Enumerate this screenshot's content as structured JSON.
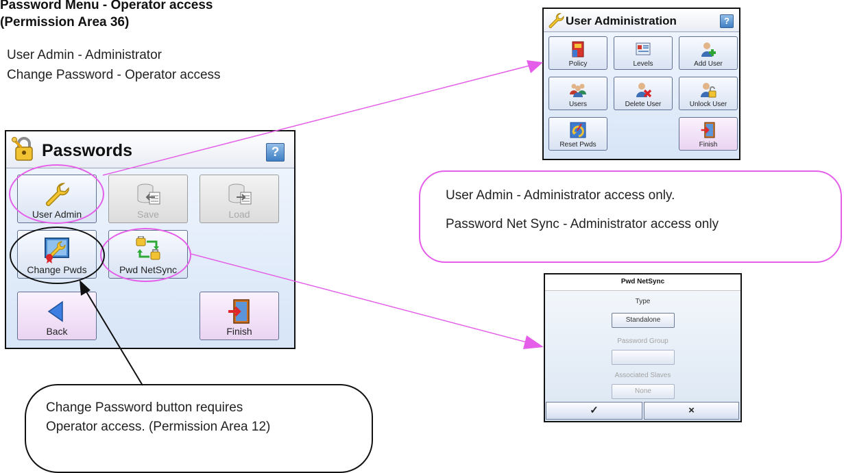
{
  "header": {
    "title_line1": "Password Menu - Operator access",
    "title_line2": "(Permission Area 36)",
    "line1": "User Admin - Administrator",
    "line2": "Change Password - Operator access"
  },
  "passwords_window": {
    "title": "Passwords",
    "help": "?",
    "buttons": [
      {
        "label": "User Admin",
        "icon": "wrench-icon",
        "enabled": true
      },
      {
        "label": "Save",
        "icon": "database-export-icon",
        "enabled": false
      },
      {
        "label": "Load",
        "icon": "database-import-icon",
        "enabled": false
      },
      {
        "label": "Change Pwds",
        "icon": "certificate-wrench-icon",
        "enabled": true
      },
      {
        "label": "Pwd NetSync",
        "icon": "sync-locks-icon",
        "enabled": true
      },
      {
        "label": "Back",
        "icon": "back-arrow-icon",
        "enabled": true
      },
      {
        "label": "Finish",
        "icon": "exit-door-icon",
        "enabled": true
      }
    ]
  },
  "user_admin_window": {
    "title": "User Administration",
    "help": "?",
    "buttons": [
      {
        "label": "Policy",
        "icon": "policy-binder-icon"
      },
      {
        "label": "Levels",
        "icon": "levels-card-icon"
      },
      {
        "label": "Add User",
        "icon": "add-user-icon"
      },
      {
        "label": "Users",
        "icon": "users-group-icon"
      },
      {
        "label": "Delete User",
        "icon": "delete-user-icon"
      },
      {
        "label": "Unlock User",
        "icon": "unlock-user-icon"
      },
      {
        "label": "Reset Pwds",
        "icon": "reset-password-icon"
      },
      {
        "label": "Finish",
        "icon": "exit-door-icon"
      }
    ]
  },
  "netsync_dialog": {
    "title": "Pwd NetSync",
    "type_label": "Type",
    "type_value": "Standalone",
    "group_label": "Password Group",
    "group_value": "",
    "slaves_label": "Associated Slaves",
    "slaves_value": "None",
    "ok": "✓",
    "cancel": "×"
  },
  "callout_admin": {
    "line1": "User Admin - Administrator access only.",
    "line2": "Password Net Sync - Administrator access only"
  },
  "callout_change": {
    "line1": "Change Password button requires",
    "line2": "Operator access. (Permission Area 12)"
  },
  "colors": {
    "highlight": "#e45ee9",
    "outline": "#111111",
    "window_accent": "#3f7fc4"
  }
}
